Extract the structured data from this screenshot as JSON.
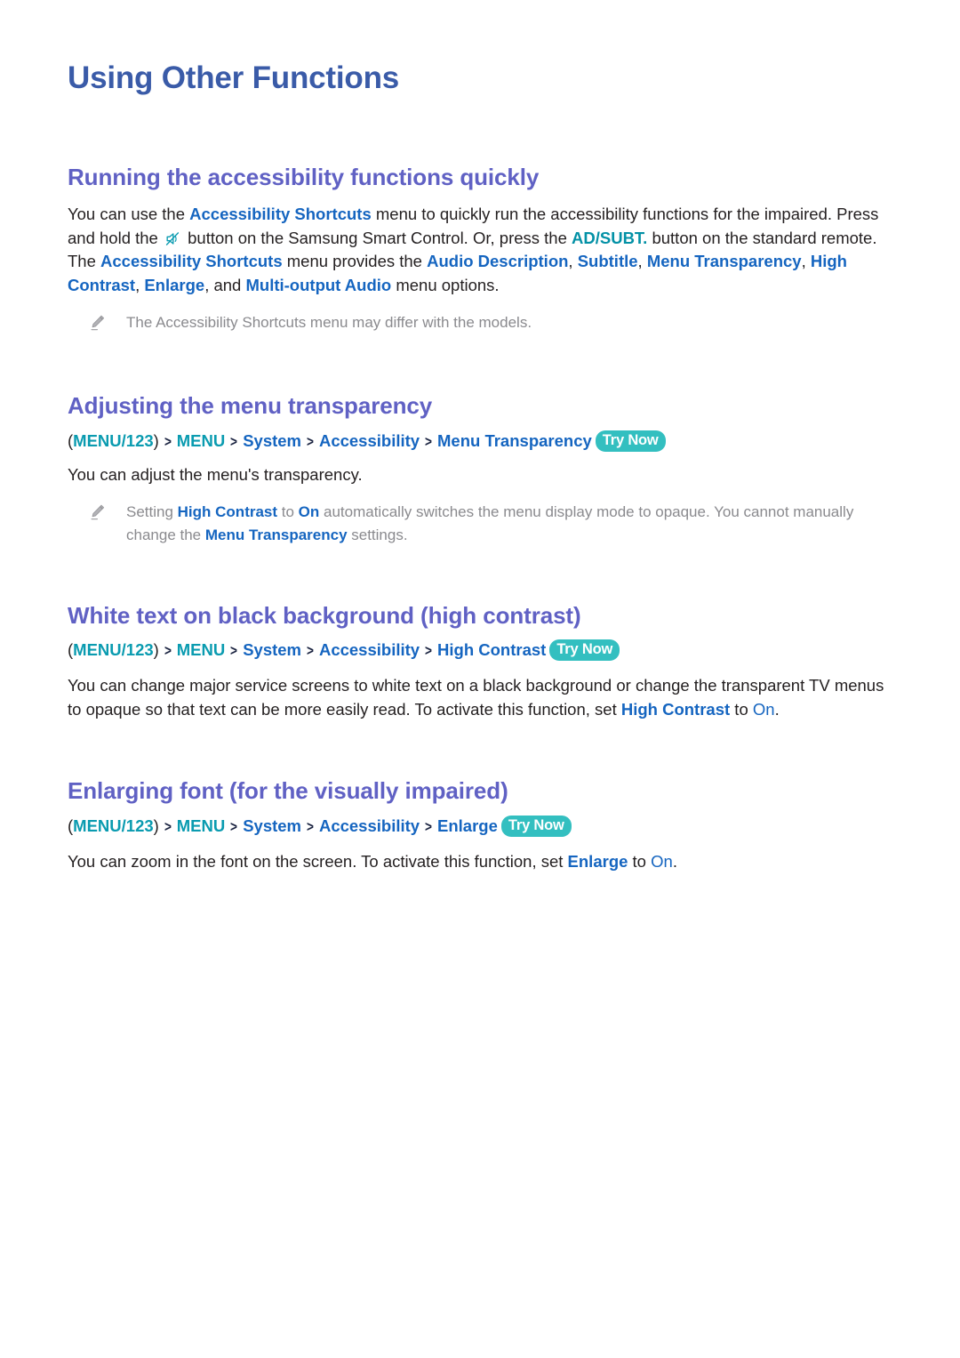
{
  "page": {
    "title": "Using Other Functions"
  },
  "icons": {
    "mute": "mute-icon",
    "pencil": "pencil-icon",
    "chevron": "chevron-right-icon"
  },
  "colors": {
    "page_title": "#3A5BA8",
    "section_heading": "#6061C4",
    "link_blue": "#1565C0",
    "teal": "#0a9bb0",
    "try_now_bg": "#33bfc0",
    "note_grey": "#8a8a8e",
    "body_black": "#231f20"
  },
  "sections": [
    {
      "heading": "Running the accessibility functions quickly",
      "paragraph": {
        "p1_a": "You can use the ",
        "p1_b": "Accessibility Shortcuts",
        "p1_c": " menu to quickly run the accessibility functions for the impaired. Press and hold the ",
        "p1_d": " button on the Samsung Smart Control. Or, press the ",
        "p1_e": "AD/SUBT.",
        "p1_f": " button on the standard remote. The ",
        "p1_g": "Accessibility Shortcuts",
        "p1_h": " menu provides the ",
        "p1_i": "Audio Description",
        "p1_j": ", ",
        "p1_k": "Subtitle",
        "p1_l": ", ",
        "p1_m": "Menu Transparency",
        "p1_n": ", ",
        "p1_o": "High Contrast",
        "p1_p": ", ",
        "p1_q": "Enlarge",
        "p1_r": ", and ",
        "p1_s": "Multi-output Audio",
        "p1_t": " menu options."
      },
      "note": {
        "text": "The Accessibility Shortcuts menu may differ with the models."
      }
    },
    {
      "heading": "Adjusting the menu transparency",
      "path": {
        "open_paren": "(",
        "menu123": "MENU/123",
        "close_paren": ")",
        "chevron": ">",
        "item1": "MENU",
        "item2": "System",
        "item3": "Accessibility",
        "item4": "Menu Transparency",
        "try_now": "Try Now"
      },
      "paragraph": {
        "text": "You can adjust the menu's transparency."
      },
      "note": {
        "a": "Setting ",
        "b": "High Contrast",
        "c": " to ",
        "d": "On",
        "e": " automatically switches the menu display mode to opaque. You cannot manually change the ",
        "f": "Menu Transparency",
        "g": " settings."
      }
    },
    {
      "heading": "White text on black background (high contrast)",
      "path": {
        "open_paren": "(",
        "menu123": "MENU/123",
        "close_paren": ")",
        "chevron": ">",
        "item1": "MENU",
        "item2": "System",
        "item3": "Accessibility",
        "item4": "High Contrast",
        "try_now": "Try Now"
      },
      "paragraph": {
        "a": "You can change major service screens to white text on a black background or change the transparent TV menus to opaque so that text can be more easily read. To activate this function, set ",
        "b": "High Contrast",
        "c": " to ",
        "d": "On",
        "e": "."
      }
    },
    {
      "heading": "Enlarging font (for the visually impaired)",
      "path": {
        "open_paren": "(",
        "menu123": "MENU/123",
        "close_paren": ")",
        "chevron": ">",
        "item1": "MENU",
        "item2": "System",
        "item3": "Accessibility",
        "item4": "Enlarge",
        "try_now": "Try Now"
      },
      "paragraph": {
        "a": "You can zoom in the font on the screen. To activate this function, set ",
        "b": "Enlarge",
        "c": " to ",
        "d": "On",
        "e": "."
      }
    }
  ]
}
